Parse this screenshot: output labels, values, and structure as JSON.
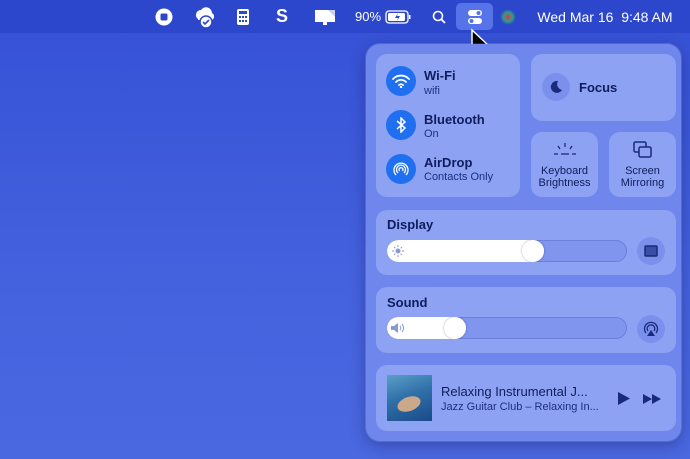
{
  "menubar": {
    "battery_percent": "90%",
    "datetime": "Wed Mar 16  9:48 AM",
    "icons": [
      "stop-record-icon",
      "cloud-sync-icon",
      "calculator-icon",
      "s-app-icon",
      "display-icon",
      "battery-charging-icon",
      "search-icon",
      "control-center-icon",
      "siri-icon"
    ]
  },
  "control_center": {
    "wifi": {
      "label": "Wi-Fi",
      "status": "wifi"
    },
    "bluetooth": {
      "label": "Bluetooth",
      "status": "On"
    },
    "airdrop": {
      "label": "AirDrop",
      "status": "Contacts Only"
    },
    "focus": {
      "label": "Focus"
    },
    "keyboard_brightness": {
      "label1": "Keyboard",
      "label2": "Brightness"
    },
    "screen_mirroring": {
      "label1": "Screen",
      "label2": "Mirroring"
    },
    "display": {
      "label": "Display",
      "brightness_percent": 62
    },
    "sound": {
      "label": "Sound",
      "volume_percent": 26
    },
    "now_playing": {
      "title": "Relaxing Instrumental J...",
      "artist": "Jazz Guitar Club – Relaxing In..."
    }
  },
  "colors": {
    "accent": "#1f6ff0",
    "menubar": "#2d47cc",
    "panel": "#6f87ec",
    "module": "#8ea2f3"
  }
}
